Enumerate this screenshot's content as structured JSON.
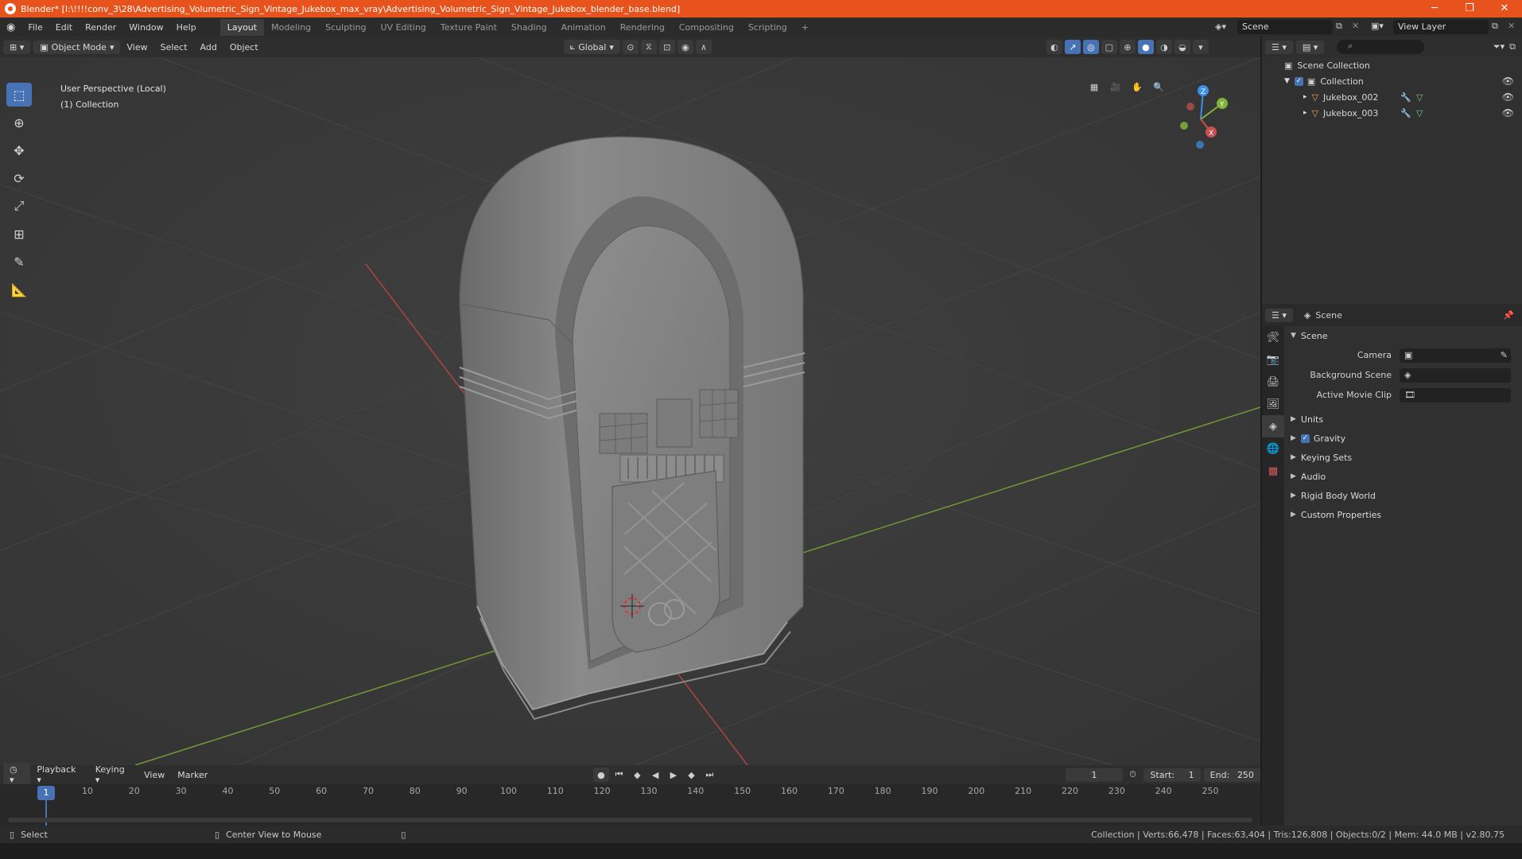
{
  "window": {
    "title": "Blender* [I:\\!!!!conv_3\\28\\Advertising_Volumetric_Sign_Vintage_Jukebox_max_vray\\Advertising_Volumetric_Sign_Vintage_Jukebox_blender_base.blend]",
    "minimize": "─",
    "maximize": "❐",
    "close": "✕"
  },
  "menu": {
    "items": [
      "File",
      "Edit",
      "Render",
      "Window",
      "Help"
    ],
    "workspaces": [
      "Layout",
      "Modeling",
      "Sculpting",
      "UV Editing",
      "Texture Paint",
      "Shading",
      "Animation",
      "Rendering",
      "Compositing",
      "Scripting"
    ],
    "active_workspace": "Layout",
    "add_workspace": "+",
    "scene": "Scene",
    "view_layer": "View Layer"
  },
  "viewport_header": {
    "mode": "Object Mode",
    "menus": [
      "View",
      "Select",
      "Add",
      "Object"
    ],
    "orientation": "Global"
  },
  "viewport": {
    "perspective": "User Perspective (Local)",
    "collection": "(1) Collection",
    "gizmo": {
      "x": "X",
      "y": "Y",
      "z": "Z"
    }
  },
  "outliner": {
    "search_placeholder": "",
    "root": "Scene Collection",
    "collection": "Collection",
    "objects": [
      "Jukebox_002",
      "Jukebox_003"
    ]
  },
  "properties": {
    "context": "Scene",
    "section_scene": "Scene",
    "camera_label": "Camera",
    "background_scene_label": "Background Scene",
    "active_movie_clip_label": "Active Movie Clip",
    "subsections": [
      "Units",
      "Gravity",
      "Keying Sets",
      "Audio",
      "Rigid Body World",
      "Custom Properties"
    ],
    "gravity_checked": true
  },
  "timeline": {
    "menus": [
      "Playback",
      "Keying",
      "View",
      "Marker"
    ],
    "current_frame": "1",
    "start_label": "Start:",
    "start": "1",
    "end_label": "End:",
    "end": "250",
    "ticks": [
      "10",
      "20",
      "30",
      "40",
      "50",
      "60",
      "70",
      "80",
      "90",
      "100",
      "110",
      "120",
      "130",
      "140",
      "150",
      "160",
      "170",
      "180",
      "190",
      "200",
      "210",
      "220",
      "230",
      "240",
      "250"
    ],
    "marker": "1"
  },
  "statusbar": {
    "select": "Select",
    "center_view": "Center View to Mouse",
    "stats": "Collection | Verts:66,478 | Faces:63,404 | Tris:126,808 | Objects:0/2 | Mem: 44.0 MB | v2.80.75"
  },
  "colors": {
    "title_bar": "#e8521c",
    "accent": "#4772b3",
    "viewport_bg": "#393939",
    "x_axis": "#c8504e",
    "y_axis": "#7fb13c",
    "z_axis": "#3d8ee8"
  }
}
